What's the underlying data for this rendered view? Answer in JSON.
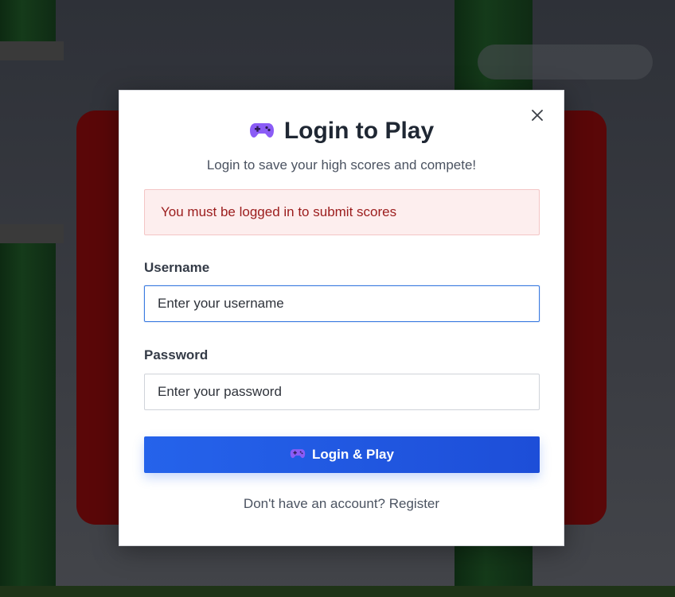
{
  "modal": {
    "title": "Login to Play",
    "subtitle": "Login to save your high scores and compete!",
    "close_icon": "close-icon",
    "error_message": "You must be logged in to submit scores",
    "username": {
      "label": "Username",
      "placeholder": "Enter your username",
      "value": ""
    },
    "password": {
      "label": "Password",
      "placeholder": "Enter your password",
      "value": ""
    },
    "login_button": {
      "icon": "game-controller-icon",
      "label": "Login & Play"
    },
    "register_prompt": {
      "text": "Don't have an account?",
      "link": "Register"
    }
  },
  "colors": {
    "accent": "#2563eb",
    "error_text": "#9b1c1c",
    "error_bg": "#fdeeee",
    "controller": "#7c3aed"
  }
}
